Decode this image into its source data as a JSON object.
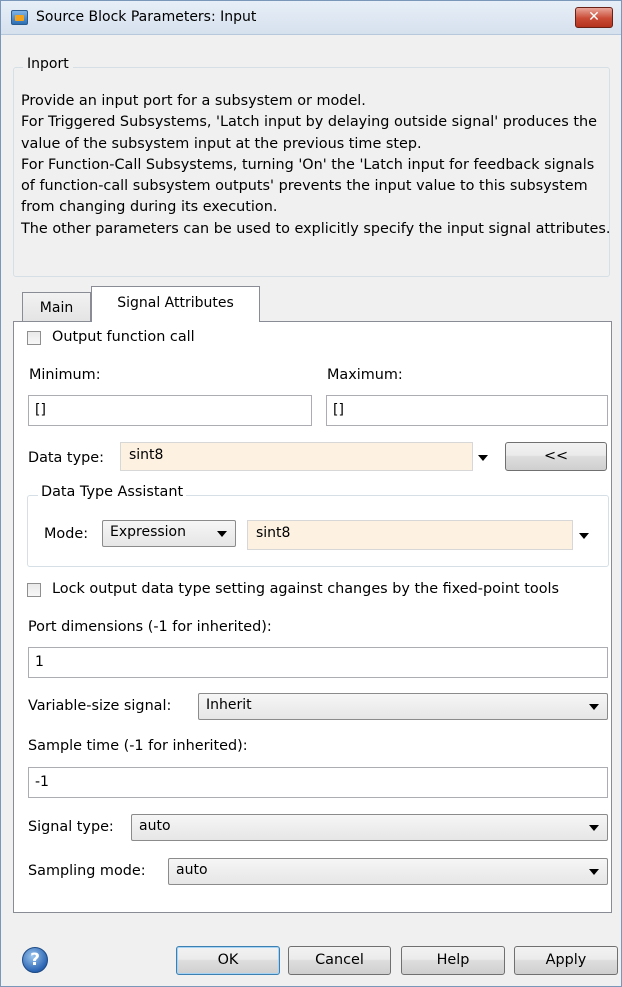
{
  "window": {
    "title": "Source Block Parameters: Input",
    "close_glyph": "✕"
  },
  "group": {
    "legend": "Inport",
    "description": "Provide an input port for a subsystem or model.\nFor Triggered Subsystems, 'Latch input by delaying outside signal' produces the value of the subsystem input at the previous time step.\nFor Function-Call Subsystems, turning 'On' the 'Latch input for feedback signals of function-call subsystem outputs' prevents the input value to this subsystem from changing during its execution.\nThe other parameters can be used to explicitly specify the input signal attributes."
  },
  "tabs": [
    {
      "label": "Main",
      "active": false
    },
    {
      "label": "Signal Attributes",
      "active": true
    }
  ],
  "signal_attributes": {
    "output_function_call": {
      "label": "Output function call",
      "checked": false
    },
    "minimum": {
      "label": "Minimum:",
      "value": "[]"
    },
    "maximum": {
      "label": "Maximum:",
      "value": "[]"
    },
    "data_type": {
      "label": "Data type:",
      "value": "sint8",
      "toggle_button": "<<"
    },
    "assistant": {
      "legend": "Data Type Assistant",
      "mode_label": "Mode:",
      "mode_value": "Expression",
      "expression_value": "sint8"
    },
    "lock_output": {
      "label": "Lock output data type setting against changes by the fixed-point tools",
      "checked": false
    },
    "port_dimensions": {
      "label": "Port dimensions (-1 for inherited):",
      "value": "1"
    },
    "variable_size": {
      "label": "Variable-size signal:",
      "value": "Inherit"
    },
    "sample_time": {
      "label": "Sample time (-1 for inherited):",
      "value": "-1"
    },
    "signal_type": {
      "label": "Signal type:",
      "value": "auto"
    },
    "sampling_mode": {
      "label": "Sampling mode:",
      "value": "auto"
    }
  },
  "buttons": {
    "ok": "OK",
    "cancel": "Cancel",
    "help": "Help",
    "apply": "Apply",
    "help_icon_glyph": "?"
  },
  "colors": {
    "assist_field_bg": "#fdf1e2",
    "close_button": "#c94a35",
    "ok_button_border": "#3c7fb1"
  }
}
